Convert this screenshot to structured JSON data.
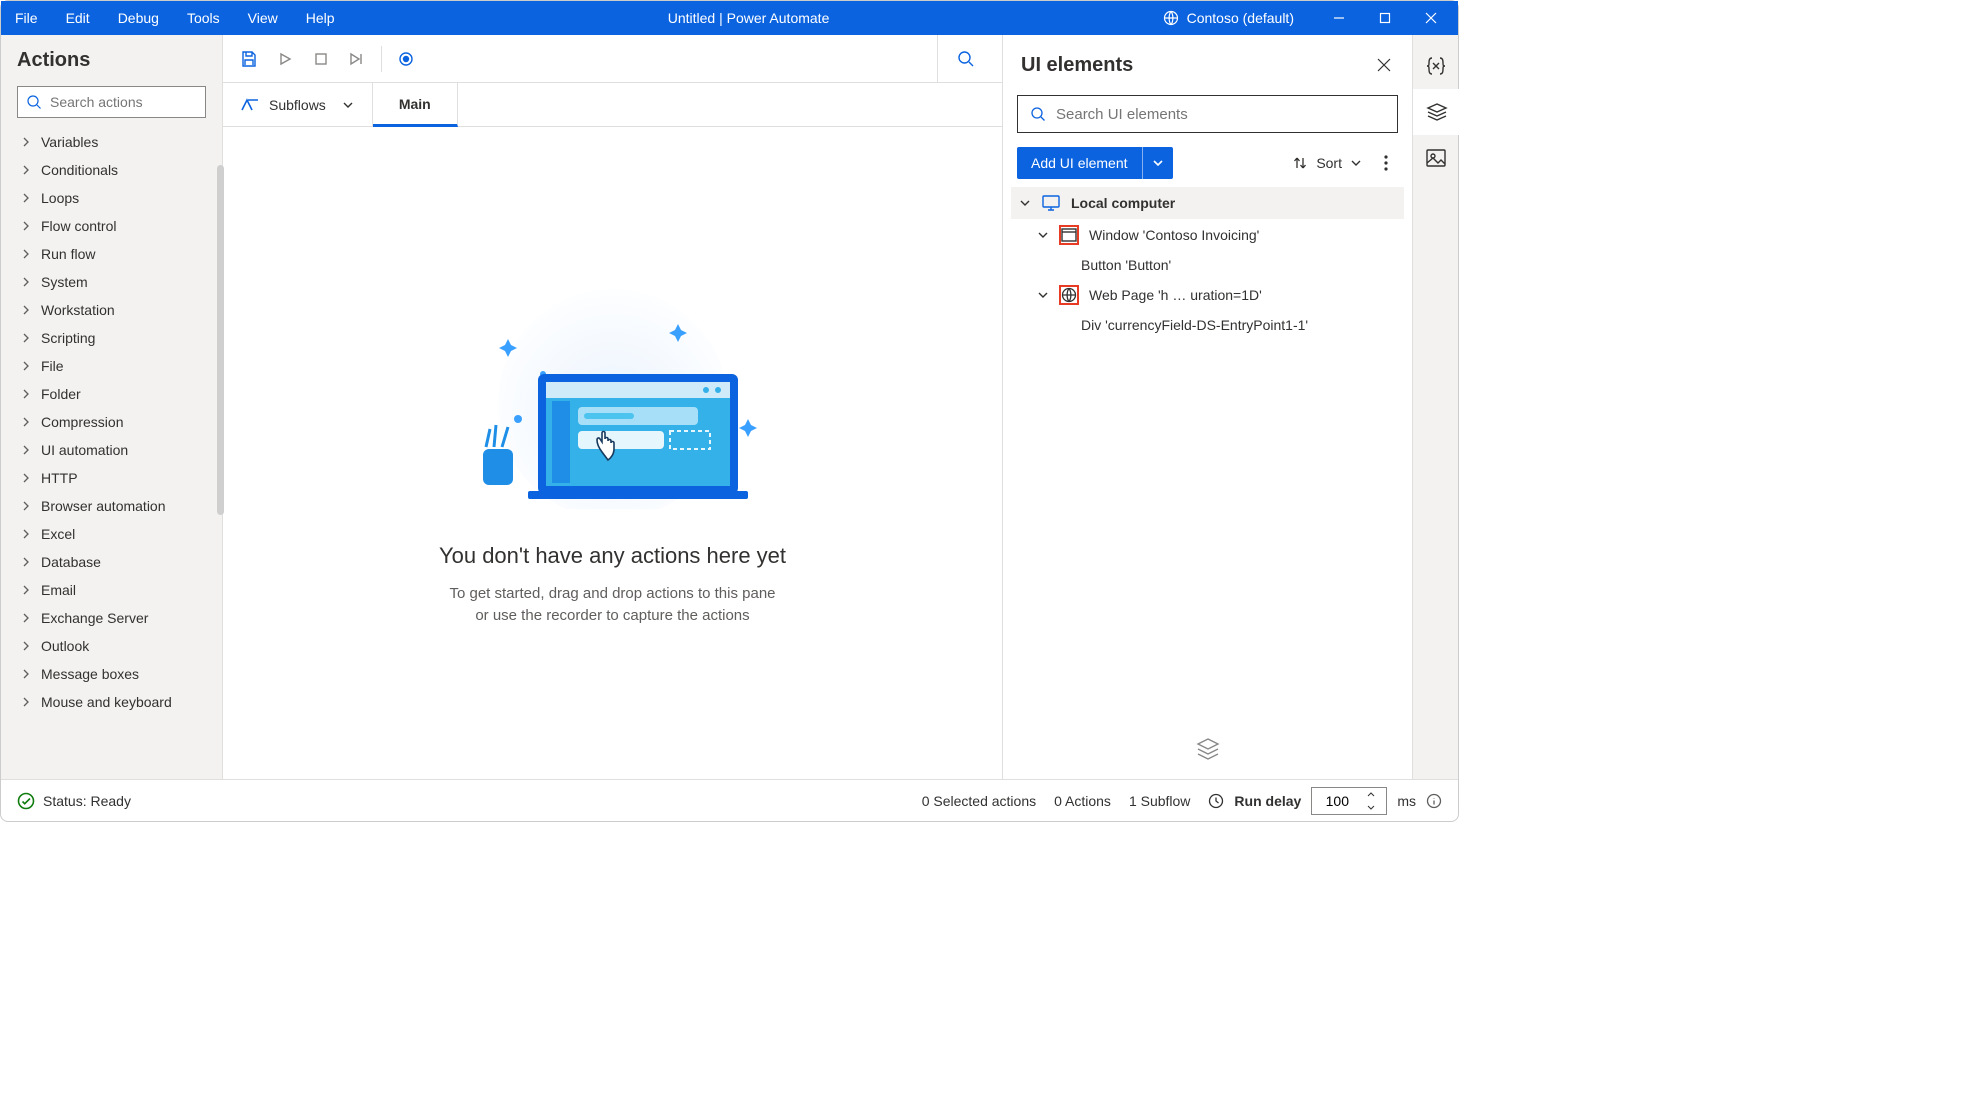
{
  "colors": {
    "brand": "#0b63e0",
    "highlight_border": "#e83b24"
  },
  "titlebar": {
    "menu": [
      "File",
      "Edit",
      "Debug",
      "Tools",
      "View",
      "Help"
    ],
    "title": "Untitled | Power Automate",
    "environment_label": "Contoso (default)"
  },
  "actions_panel": {
    "heading": "Actions",
    "search_placeholder": "Search actions",
    "categories": [
      "Variables",
      "Conditionals",
      "Loops",
      "Flow control",
      "Run flow",
      "System",
      "Workstation",
      "Scripting",
      "File",
      "Folder",
      "Compression",
      "UI automation",
      "HTTP",
      "Browser automation",
      "Excel",
      "Database",
      "Email",
      "Exchange Server",
      "Outlook",
      "Message boxes",
      "Mouse and keyboard"
    ]
  },
  "center": {
    "subflows_label": "Subflows",
    "tab_main": "Main",
    "empty_heading": "You don't have any actions here yet",
    "empty_line1": "To get started, drag and drop actions to this pane",
    "empty_line2": "or use the recorder to capture the actions"
  },
  "ui_panel": {
    "heading": "UI elements",
    "search_placeholder": "Search UI elements",
    "add_button_label": "Add UI element",
    "sort_label": "Sort",
    "tree": {
      "root_label": "Local computer",
      "window_label": "Window 'Contoso Invoicing'",
      "window_child_label": "Button 'Button'",
      "web_label": "Web Page 'h … uration=1D'",
      "web_child_label": "Div 'currencyField-DS-EntryPoint1-1'"
    }
  },
  "statusbar": {
    "status_text": "Status: Ready",
    "selected": "0 Selected actions",
    "actions_count": "0 Actions",
    "subflow_count": "1 Subflow",
    "run_delay_label": "Run delay",
    "run_delay_value": "100",
    "run_delay_unit": "ms"
  }
}
